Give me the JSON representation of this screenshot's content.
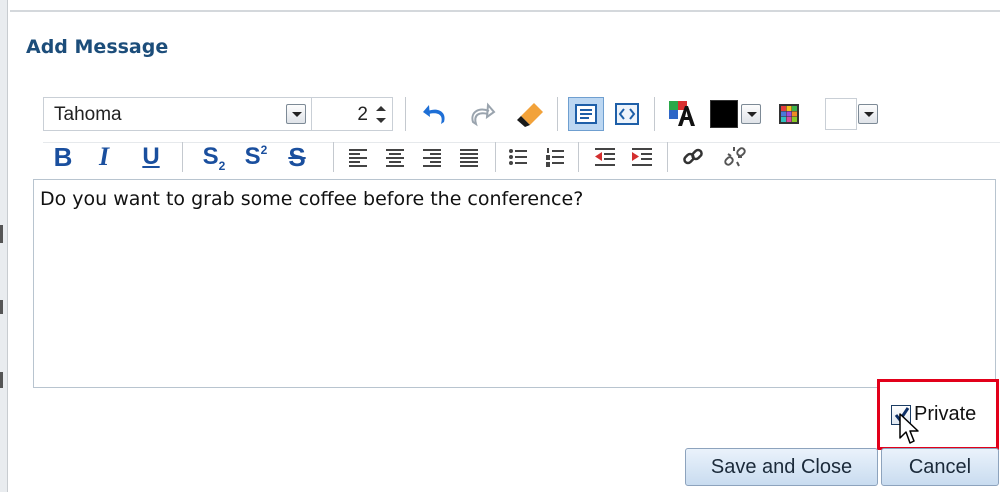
{
  "dialog": {
    "title": "Add Message"
  },
  "toolbar": {
    "font_family": "Tahoma",
    "font_size": "2",
    "text_color": "#000000",
    "background_color": "#ffffff",
    "icons_row1": [
      "undo-icon",
      "redo-icon",
      "eraser-icon",
      "rich-text-mode-icon",
      "source-code-mode-icon",
      "font-color-icon",
      "color-swatch-icon",
      "color-grid-icon"
    ],
    "format": {
      "bold": "B",
      "italic": "I",
      "underline": "U",
      "subscript_base": "S",
      "subscript_mark": "2",
      "superscript_base": "S",
      "superscript_mark": "2",
      "strikethrough": "S"
    },
    "icons_row2": [
      "align-left-icon",
      "align-center-icon",
      "align-right-icon",
      "justify-icon",
      "bullet-list-icon",
      "numbered-list-icon",
      "outdent-icon",
      "indent-icon",
      "link-icon",
      "unlink-icon"
    ]
  },
  "editor": {
    "content": "Do you want to grab some coffee before the conference?"
  },
  "private_checkbox": {
    "label": "Private",
    "checked": true,
    "highlight_color": "#e2001a"
  },
  "buttons": {
    "save_close": "Save and Close",
    "cancel": "Cancel"
  }
}
